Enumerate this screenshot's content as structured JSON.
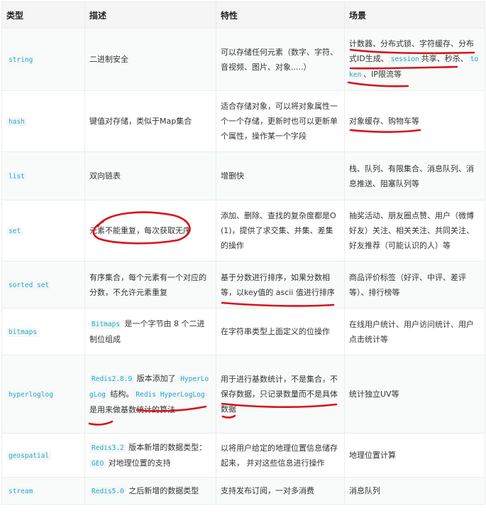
{
  "headers": {
    "type": "类型",
    "desc": "描述",
    "feature": "特性",
    "scene": "场景"
  },
  "rows": [
    {
      "type": "string",
      "desc": [
        {
          "t": "二进制安全"
        }
      ],
      "feature": [
        {
          "t": "可以存储任何元素（数字、字符、音视频、图片、对象.....）"
        }
      ],
      "scene": [
        {
          "t": "计数器、分布式锁、字符缓存、分布式ID生成、"
        },
        {
          "t": "session",
          "c": true
        },
        {
          "t": "共享、秒杀、"
        },
        {
          "t": "token",
          "c": true
        },
        {
          "t": "、IP限流等"
        }
      ]
    },
    {
      "type": "hash",
      "desc": [
        {
          "t": "键值对存储，类似于Map集合"
        }
      ],
      "feature": [
        {
          "t": "适合存储对象，可以将对象属性一个一个存储，更新时也可以更新单个属性，操作某一个字段"
        }
      ],
      "scene": [
        {
          "t": "对象缓存、购物车等"
        }
      ]
    },
    {
      "type": "list",
      "desc": [
        {
          "t": "双向链表"
        }
      ],
      "feature": [
        {
          "t": "增删快"
        }
      ],
      "scene": [
        {
          "t": "栈、队列、有限集合、消息队列、消息推送、阻塞队列等"
        }
      ]
    },
    {
      "type": "set",
      "desc": [
        {
          "t": "元素不能重复，每次获取无序"
        }
      ],
      "feature": [
        {
          "t": "添加、删除、查找的复杂度都是O(1)，提供了求交集、并集、差集的操作"
        }
      ],
      "scene": [
        {
          "t": "抽奖活动、朋友圈点赞、用户（微博好友）关注、相关关注、共同关注、好友推荐（可能认识的人）等"
        }
      ]
    },
    {
      "type": "sorted set",
      "desc": [
        {
          "t": "有序集合，每个元素有一个对应的分数，不允许元素重复"
        }
      ],
      "feature": [
        {
          "t": "基于分数进行排序，如果分数相等，以key值的 ascii 值进行排序"
        }
      ],
      "scene": [
        {
          "t": "商品评价标签（好评、中评、差评等）、排行榜等"
        }
      ]
    },
    {
      "type": "bitmaps",
      "desc": [
        {
          "t": "Bitmaps",
          "c": true
        },
        {
          "t": " 是一个字节由 8 个二进制位组成"
        }
      ],
      "feature": [
        {
          "t": "在字符串类型上面定义的位操作"
        }
      ],
      "scene": [
        {
          "t": "在线用户统计、用户访问统计、用户点击统计等"
        }
      ]
    },
    {
      "type": "hyperloglog",
      "desc": [
        {
          "t": "Redis2.8.9",
          "c": true
        },
        {
          "t": " 版本添加了 "
        },
        {
          "t": "HyperLogLog",
          "c": true
        },
        {
          "t": " 结构。"
        },
        {
          "t": "Redis HyperLogLog",
          "c": true
        },
        {
          "t": " 是用来做基数统计的算法"
        }
      ],
      "feature": [
        {
          "t": "用于进行基数统计，不是集合，不保存数据，只记录数量而不是具体数据"
        }
      ],
      "scene": [
        {
          "t": "统计独立UV等"
        }
      ]
    },
    {
      "type": "geospatial",
      "desc": [
        {
          "t": "Redis3.2",
          "c": true
        },
        {
          "t": " 版本新增的数据类型："
        },
        {
          "t": "GEO",
          "c": true
        },
        {
          "t": " 对地理位置的支持"
        }
      ],
      "feature": [
        {
          "t": "以将用户给定的地理位置信息储存起来， 并对这些信息进行操作"
        }
      ],
      "scene": [
        {
          "t": "地理位置计算"
        }
      ]
    },
    {
      "type": "stream",
      "desc": [
        {
          "t": "Redis5.0",
          "c": true
        },
        {
          "t": " 之后新增的数据类型"
        }
      ],
      "feature": [
        {
          "t": "支持发布订阅，一对多消费"
        }
      ],
      "scene": [
        {
          "t": "消息队列"
        }
      ]
    }
  ]
}
